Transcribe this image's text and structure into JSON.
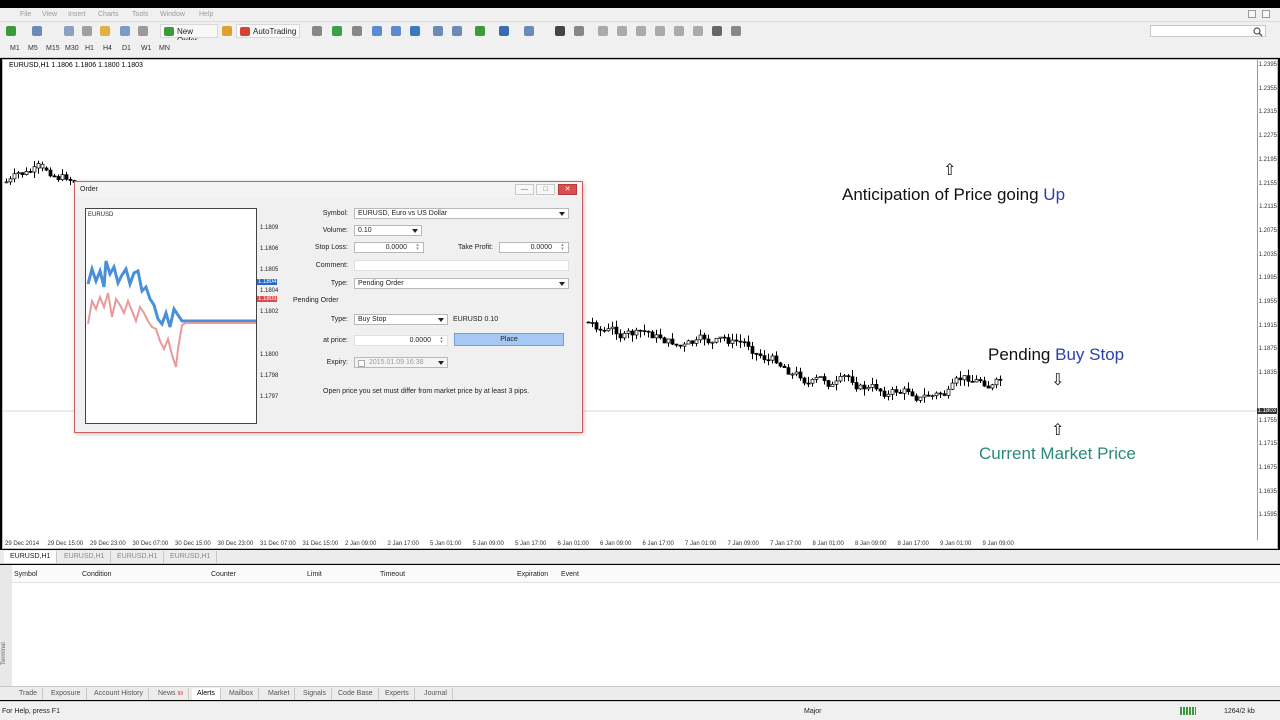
{
  "menu": {
    "items": [
      "File",
      "View",
      "Insert",
      "Charts",
      "Tools",
      "Window",
      "Help"
    ]
  },
  "toolbar": {
    "new_order": "New Order",
    "autotrading": "AutoTrading"
  },
  "timeframes": [
    "M1",
    "M5",
    "M15",
    "M30",
    "H1",
    "H4",
    "D1",
    "W1",
    "MN"
  ],
  "chart": {
    "title": "EURUSD,H1  1.1806 1.1806 1.1800 1.1803",
    "price_ticks": [
      "1.2395",
      "1.2355",
      "1.2315",
      "1.2275",
      "1.2195",
      "1.2155",
      "1.2115",
      "1.2075",
      "1.2035",
      "1.1995",
      "1.1955",
      "1.1915",
      "1.1875",
      "1.1835",
      "1.1803",
      "1.1755",
      "1.1715",
      "1.1675",
      "1.1635",
      "1.1595"
    ],
    "time_ticks": [
      "29 Dec 2014",
      "29 Dec 15:00",
      "29 Dec 23:00",
      "30 Dec 07:00",
      "30 Dec 15:00",
      "30 Dec 23:00",
      "31 Dec 07:00",
      "31 Dec 15:00",
      "2 Jan 09:00",
      "2 Jan 17:00",
      "5 Jan 01:00",
      "5 Jan 09:00",
      "5 Jan 17:00",
      "6 Jan 01:00",
      "6 Jan 09:00",
      "6 Jan 17:00",
      "7 Jan 01:00",
      "7 Jan 09:00",
      "7 Jan 17:00",
      "8 Jan 01:00",
      "8 Jan 09:00",
      "8 Jan 17:00",
      "9 Jan 01:00",
      "9 Jan 09:00"
    ],
    "annotations": {
      "anticipation_prefix": "Anticipation of Price going ",
      "anticipation_highlight": "Up",
      "pending_prefix": "Pending ",
      "pending_highlight": "Buy Stop",
      "current_price": "Current Market Price"
    },
    "arrows": {
      "up": "⇧",
      "down": "⇩"
    }
  },
  "chart_tabs": [
    "EURUSD,H1",
    "EURUSD,H1",
    "EURUSD,H1",
    "EURUSD,H1"
  ],
  "order_dialog": {
    "title": "Order",
    "tick_chart_symbol": "EURUSD",
    "tick_prices": [
      "1.1809",
      "1.1806",
      "1.1805",
      "1.1804",
      "1.1803",
      "1.1802",
      "1.1800",
      "1.1798",
      "1.1797"
    ],
    "tick_ask": "1.1804",
    "tick_bid": "1.1803",
    "symbol_label": "Symbol:",
    "symbol_value": "EURUSD, Euro vs US Dollar",
    "volume_label": "Volume:",
    "volume_value": "0.10",
    "stop_loss_label": "Stop Loss:",
    "stop_loss_value": "0.0000",
    "take_profit_label": "Take Profit:",
    "take_profit_value": "0.0000",
    "comment_label": "Comment:",
    "comment_value": "",
    "type_label": "Type:",
    "type_value": "Pending Order",
    "pending_section": "Pending Order",
    "pending_type_label": "Type:",
    "pending_type_value": "Buy Stop",
    "pending_summary": "EURUSD 0.10",
    "at_price_label": "at price:",
    "at_price_value": "0.0000",
    "place_label": "Place",
    "expiry_label": "Expiry:",
    "expiry_value": "2015.01.09 16:38",
    "hint": "Open price you set must differ from market price by at least 3 pips."
  },
  "terminal": {
    "side_label": "Terminal",
    "columns": [
      "Symbol",
      "Condition",
      "Counter",
      "Limit",
      "Timeout",
      "Expiration",
      "Event"
    ],
    "tabs": [
      "Trade",
      "Exposure",
      "Account History",
      "News",
      "Alerts",
      "Mailbox",
      "Market",
      "Signals",
      "Code Base",
      "Experts",
      "Journal"
    ],
    "news_badge": "99",
    "active_tab": "Alerts"
  },
  "status": {
    "help": "For Help, press F1",
    "profile": "Major",
    "traffic": "1264/2 kb"
  },
  "colors": {
    "annotation_blue": "#2a3fb0",
    "annotation_teal": "#2a8a7a",
    "ask_blue": "#2468d0",
    "bid_red": "#e24848",
    "place_button": "#a6c8f4"
  }
}
